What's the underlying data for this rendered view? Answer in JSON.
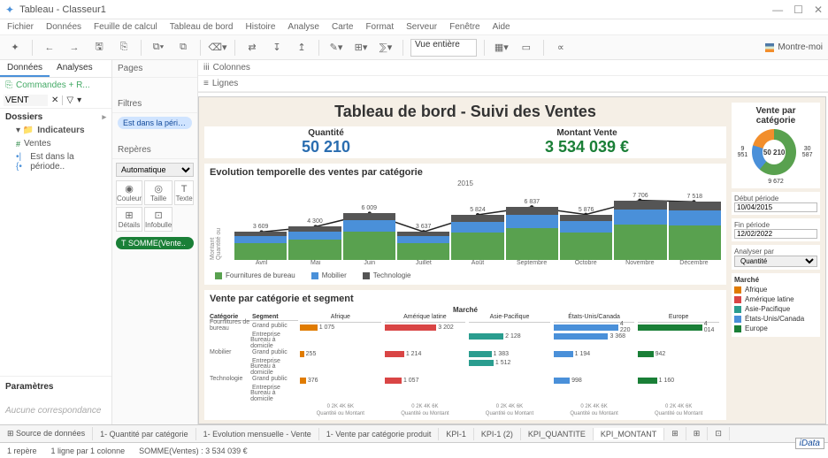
{
  "window": {
    "app": "Tableau",
    "file": "Classeur1",
    "min": "—",
    "max": "☐",
    "close": "✕"
  },
  "menubar": [
    "Fichier",
    "Données",
    "Feuille de calcul",
    "Tableau de bord",
    "Histoire",
    "Analyse",
    "Carte",
    "Format",
    "Serveur",
    "Fenêtre",
    "Aide"
  ],
  "toolbar": {
    "view": "Vue entière",
    "montre": "Montre-moi"
  },
  "left": {
    "tabs": [
      "Données",
      "Analyses"
    ],
    "datasource": "Commandes + R...",
    "ventField": "VENT",
    "dossiers": "Dossiers",
    "indicateurs": "Indicateurs",
    "ventes": "Ventes",
    "periode": "Est dans la période..",
    "parametres": "Paramètres",
    "nocorr": "Aucune correspondance"
  },
  "mid": {
    "pages": "Pages",
    "filtres": "Filtres",
    "filtrePill": "Est dans la période d..",
    "reperes": "Repères",
    "auto": "Automatique",
    "marks": [
      "Couleur",
      "Taille",
      "Texte",
      "Détails",
      "Infobulle"
    ],
    "measurePill": "SOMME(Vente.."
  },
  "shelves": {
    "colonnes": "Colonnes",
    "lignes": "Lignes"
  },
  "dash": {
    "title": "Tableau de bord - Suivi des Ventes",
    "kpi1": {
      "label": "Quantité",
      "value": "50 210"
    },
    "kpi2": {
      "label": "Montant Vente",
      "value": "3 534 039 €"
    },
    "evo": {
      "title": "Evolution temporelle des ventes par catégorie",
      "year": "2015",
      "ylab": "Quantité ou\nMontant",
      "months": [
        "Avril",
        "Mai",
        "Juin",
        "Juillet",
        "Août",
        "Septembre",
        "Octobre",
        "Novembre",
        "Décembre"
      ],
      "labels": [
        "3 609",
        "4 300",
        "6 009",
        "3 637",
        "5 824",
        "6 837",
        "5 876",
        "7 706",
        "7 518"
      ]
    },
    "legend": [
      "Fournitures de bureau",
      "Mobilier",
      "Technologie"
    ],
    "catseg": {
      "title": "Vente par catégorie et segment",
      "hCat": "Catégorie",
      "hSeg": "Segment",
      "catRows": [
        [
          "Fournitures de bureau",
          "Grand public"
        ],
        [
          "",
          "Entreprise"
        ],
        [
          "",
          "Bureau à domicile"
        ],
        [
          "Mobilier",
          "Grand public"
        ],
        [
          "",
          "Entreprise"
        ],
        [
          "",
          "Bureau à domicile"
        ],
        [
          "Technologie",
          "Grand public"
        ],
        [
          "",
          "Entreprise"
        ],
        [
          "",
          "Bureau à domicile"
        ]
      ],
      "marche": "Marché",
      "markets": [
        "Afrique",
        "Amérique latine",
        "Asie-Pacifique",
        "États-Unis/Canada",
        "Europe"
      ],
      "vals": {
        "Afrique": [
          "1 075",
          "",
          "",
          "255",
          "",
          "",
          "376",
          "",
          ""
        ],
        "Amérique latine": [
          "3 202",
          "",
          "",
          "1 214",
          "",
          "",
          "1 057",
          "",
          ""
        ],
        "Asie-Pacifique": [
          "",
          "2 128",
          "",
          "1 383",
          "1 512",
          "",
          "",
          "",
          ""
        ],
        "États-Unis/Canada": [
          "4 220",
          "3 368",
          "",
          "1 194",
          "",
          "",
          "998",
          "",
          ""
        ],
        "Europe": [
          "4 014",
          "",
          "",
          "942",
          "",
          "",
          "1 160",
          "",
          ""
        ]
      },
      "xlab": "Quantité ou Montant",
      "xticks": "0  2K  4K  6K"
    },
    "donut": {
      "title": "Vente par catégorie",
      "center": "50 210",
      "labs": [
        "9 951",
        "30 587",
        "9 672"
      ]
    },
    "filters": {
      "debut": {
        "label": "Début période",
        "value": "10/04/2015"
      },
      "fin": {
        "label": "Fin période",
        "value": "12/02/2022"
      },
      "analyser": {
        "label": "Analyser par",
        "value": "Quantité"
      }
    },
    "mktlist": {
      "title": "Marché",
      "items": [
        "Afrique",
        "Amérique latine",
        "Asie-Pacifique",
        "États-Unis/Canada",
        "Europe"
      ]
    }
  },
  "bottomtabs": [
    "Source de données",
    "1- Quantité par catégorie",
    "1- Evolution mensuelle - Vente",
    "1- Vente par catégorie produit",
    "KPI-1",
    "KPI-1 (2)",
    "KPI_QUANTITE",
    "KPI_MONTANT"
  ],
  "statusbar": {
    "repere": "1 repère",
    "ligne": "1 ligne par 1 colonne",
    "somme": "SOMME(Ventes) : 3 534 039 €"
  },
  "brand": "iData",
  "chart_data": {
    "type": "bar",
    "title": "Evolution temporelle des ventes par catégorie",
    "categories": [
      "Avril",
      "Mai",
      "Juin",
      "Juillet",
      "Août",
      "Septembre",
      "Octobre",
      "Novembre",
      "Décembre"
    ],
    "values": [
      3609,
      4300,
      6009,
      3637,
      5824,
      6837,
      5876,
      7706,
      7518
    ],
    "series_stack": [
      "Fournitures de bureau",
      "Mobilier",
      "Technologie"
    ],
    "xlabel": "",
    "ylabel": "Quantité ou Montant",
    "ylim": [
      0,
      8000
    ]
  }
}
